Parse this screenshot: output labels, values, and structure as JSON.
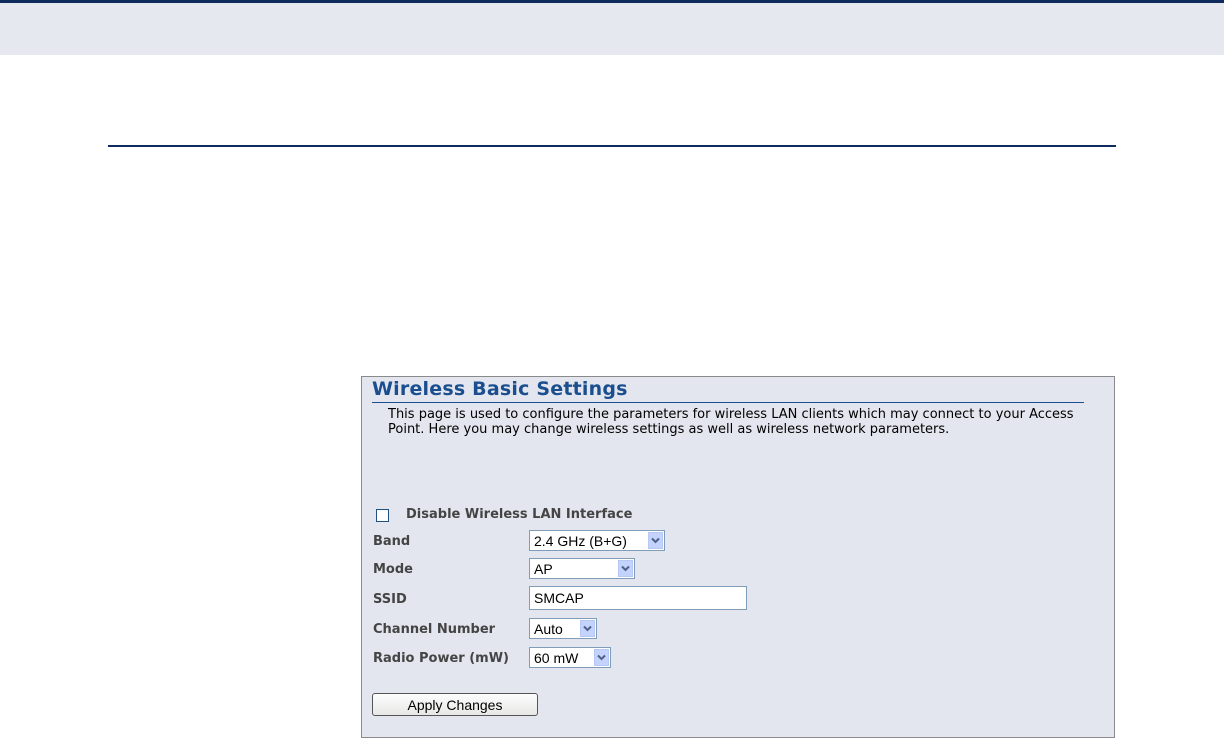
{
  "panel": {
    "title": "Wireless Basic Settings",
    "description": "This page is used to configure the parameters for wireless LAN clients which may connect to your Access Point. Here you may change wireless settings as well as wireless network parameters."
  },
  "form": {
    "disable_checkbox": {
      "label": "Disable Wireless LAN Interface",
      "checked": false
    },
    "band": {
      "label": "Band",
      "value": "2.4 GHz (B+G)"
    },
    "mode": {
      "label": "Mode",
      "value": "AP"
    },
    "ssid": {
      "label": "SSID",
      "value": "SMCAP"
    },
    "channel": {
      "label": "Channel Number",
      "value": "Auto"
    },
    "radio_power": {
      "label": "Radio Power (mW)",
      "value": "60 mW"
    },
    "apply_label": "Apply Changes"
  },
  "colors": {
    "header_navy": "#0f2a5c",
    "title_blue": "#1a4e8f",
    "panel_bg": "#e3e6ee",
    "select_arrow_bg": "#c3d3fd"
  },
  "icons": {
    "select_arrow": "chevron-down-icon"
  }
}
